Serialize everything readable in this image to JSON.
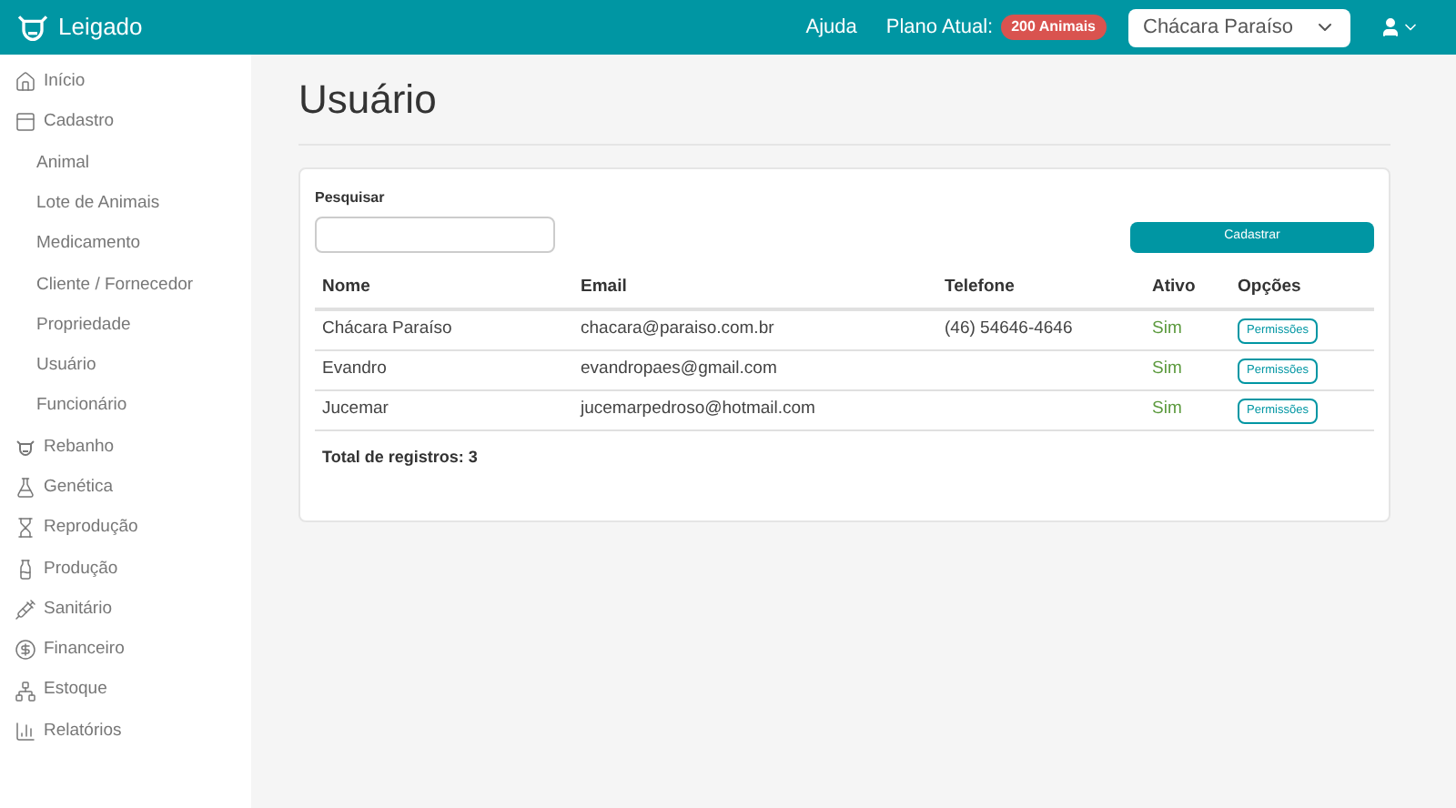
{
  "brand": "Leigado",
  "topbar": {
    "help": "Ajuda",
    "plan_label": "Plano Atual:",
    "plan_badge": "200 Animais",
    "property_select": "Chácara Paraíso"
  },
  "sidebar": {
    "items": [
      {
        "label": "Início"
      },
      {
        "label": "Cadastro",
        "children": [
          {
            "label": "Animal"
          },
          {
            "label": "Lote de Animais"
          },
          {
            "label": "Medicamento"
          },
          {
            "label": "Cliente / Fornecedor"
          },
          {
            "label": "Propriedade"
          },
          {
            "label": "Usuário"
          },
          {
            "label": "Funcionário"
          }
        ]
      },
      {
        "label": "Rebanho"
      },
      {
        "label": "Genética"
      },
      {
        "label": "Reprodução"
      },
      {
        "label": "Produção"
      },
      {
        "label": "Sanitário"
      },
      {
        "label": "Financeiro"
      },
      {
        "label": "Estoque"
      },
      {
        "label": "Relatórios"
      }
    ]
  },
  "page_title": "Usuário",
  "search": {
    "label": "Pesquisar"
  },
  "create_button": "Cadastrar",
  "table": {
    "columns": [
      "Nome",
      "Email",
      "Telefone",
      "Ativo",
      "Opções"
    ],
    "rows": [
      {
        "name": "Chácara Paraíso",
        "email": "chacara@paraiso.com.br",
        "phone": "(46) 54646-4646",
        "active": "Sim",
        "action": "Permissões"
      },
      {
        "name": "Evandro",
        "email": "evandropaes@gmail.com",
        "active": "Sim",
        "action": "Permissões"
      },
      {
        "name": "Jucemar",
        "email": "jucemarpedroso@hotmail.com",
        "active": "Sim",
        "action": "Permissões"
      }
    ]
  },
  "total": "Total de registros: 3"
}
